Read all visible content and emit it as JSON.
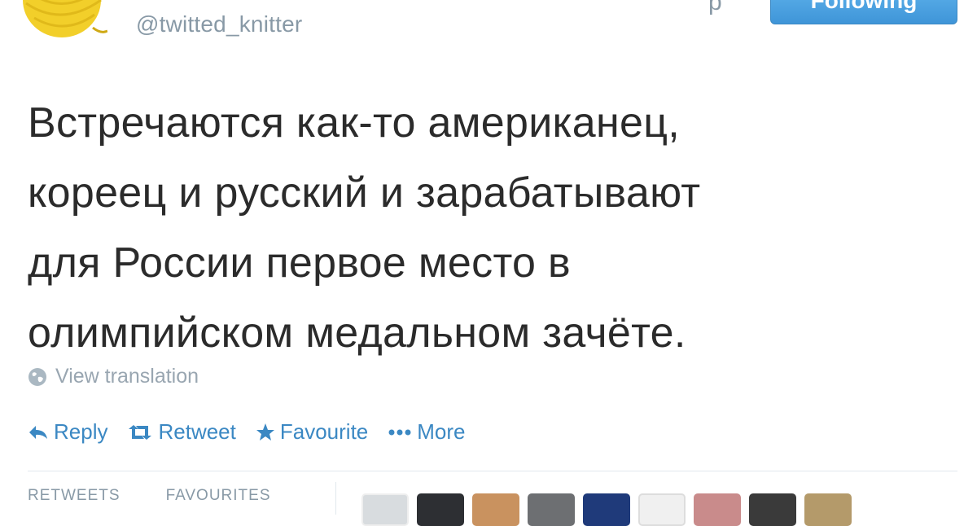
{
  "user": {
    "handle": "@twitted_knitter",
    "name_visible_fragment": "р",
    "avatar_icon": "yarn-ball-icon"
  },
  "header": {
    "follow_button_label": "Following"
  },
  "tweet": {
    "lines": [
      "Встречаются как-то американец,",
      "кореец и русский и зарабатывают",
      "для России первое место в",
      "олимпийском медальном зачёте."
    ]
  },
  "translation": {
    "label": "View translation",
    "icon": "globe-icon"
  },
  "actions": {
    "reply": "Reply",
    "retweet": "Retweet",
    "favourite": "Favourite",
    "more": "More"
  },
  "stats": {
    "retweets_label": "RETWEETS",
    "favourites_label": "FAVOURITES"
  },
  "colors": {
    "accent": "#3b88c3",
    "muted": "#8899a6",
    "avatar_yarn": "#f5d11c",
    "follow_button": "#4fa3e3"
  },
  "favourited_by_avatars": [
    "avatar-1",
    "avatar-2",
    "avatar-3",
    "avatar-4",
    "avatar-5",
    "avatar-6",
    "avatar-7",
    "avatar-8",
    "avatar-9"
  ]
}
